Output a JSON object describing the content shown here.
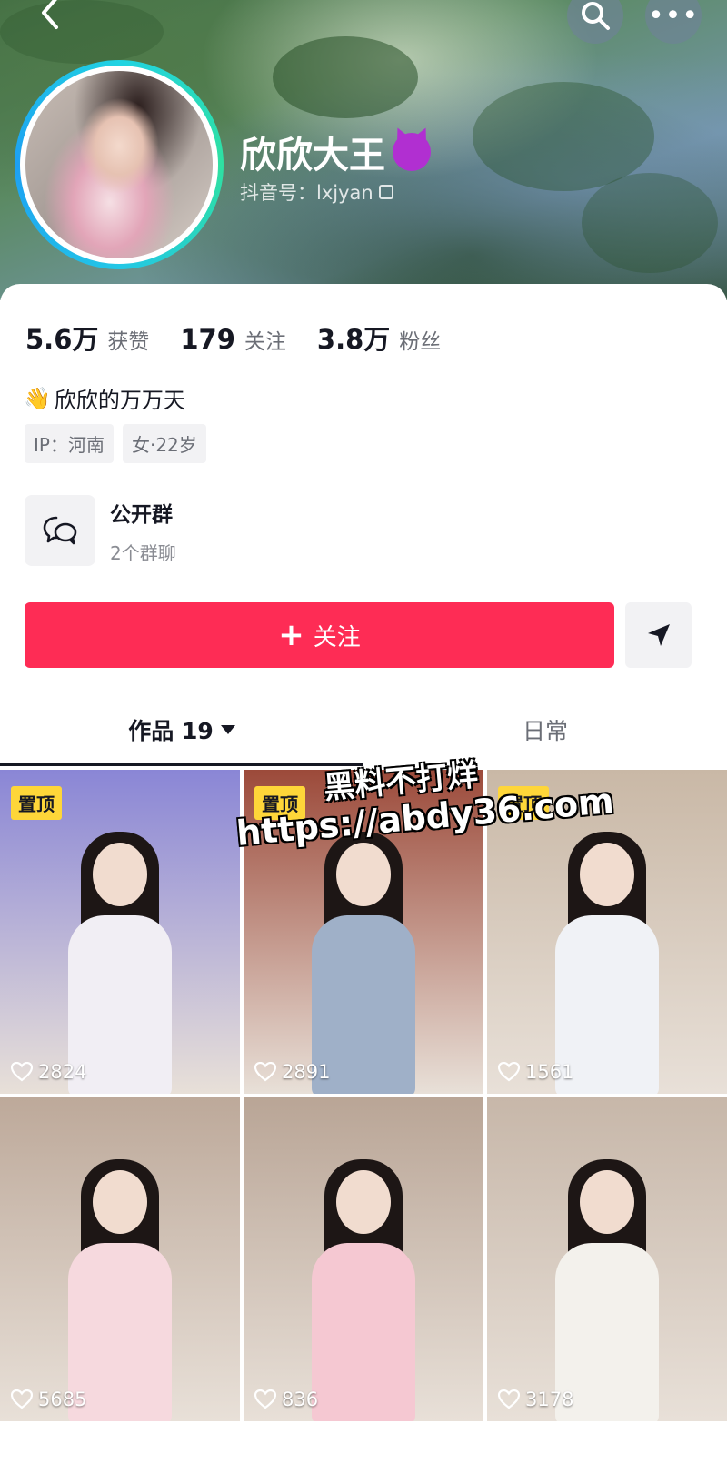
{
  "header": {
    "back_icon": "chevron-left-icon",
    "search_icon": "search-icon",
    "more_icon": "more-dots-icon",
    "more_label": "•••"
  },
  "profile": {
    "nickname": "欣欣大王",
    "emoji": "😈",
    "douyin_id": "抖音号：lxjyan",
    "stats": [
      {
        "value": "5.6万",
        "label": "获赞"
      },
      {
        "value": "179",
        "label": "关注"
      },
      {
        "value": "3.8万",
        "label": "粉丝"
      }
    ],
    "bio": "欣欣的万万天",
    "bio_emoji": "👋",
    "tags": [
      "IP：河南",
      "女·22岁"
    ]
  },
  "group": {
    "title": "公开群",
    "subtitle": "2个群聊"
  },
  "actions": {
    "follow_plus": "+",
    "follow_label": "关注"
  },
  "tabs": {
    "works": "作品 19",
    "daily": "日常"
  },
  "pin_label": "置顶",
  "videos": [
    {
      "likes": "2824",
      "pinned": true,
      "bg": "#8a86d6",
      "outfit": "#f1eef4"
    },
    {
      "likes": "2891",
      "pinned": true,
      "bg": "#9c4a3a",
      "outfit": "#9fb0c8"
    },
    {
      "likes": "1561",
      "pinned": true,
      "bg": "#c9b8a6",
      "outfit": "#f0f2f6"
    },
    {
      "likes": "5685",
      "pinned": false,
      "bg": "#bda99a",
      "outfit": "#f6d9de"
    },
    {
      "likes": "836",
      "pinned": false,
      "bg": "#b9a596",
      "outfit": "#f5c8d2"
    },
    {
      "likes": "3178",
      "pinned": false,
      "bg": "#c7b7a9",
      "outfit": "#f3f1ec"
    }
  ],
  "watermark": {
    "line1": "黑料不打烊",
    "line2": "https://abdy36.com"
  },
  "colors": {
    "accent": "#fe2c55",
    "pin": "#fed639"
  }
}
